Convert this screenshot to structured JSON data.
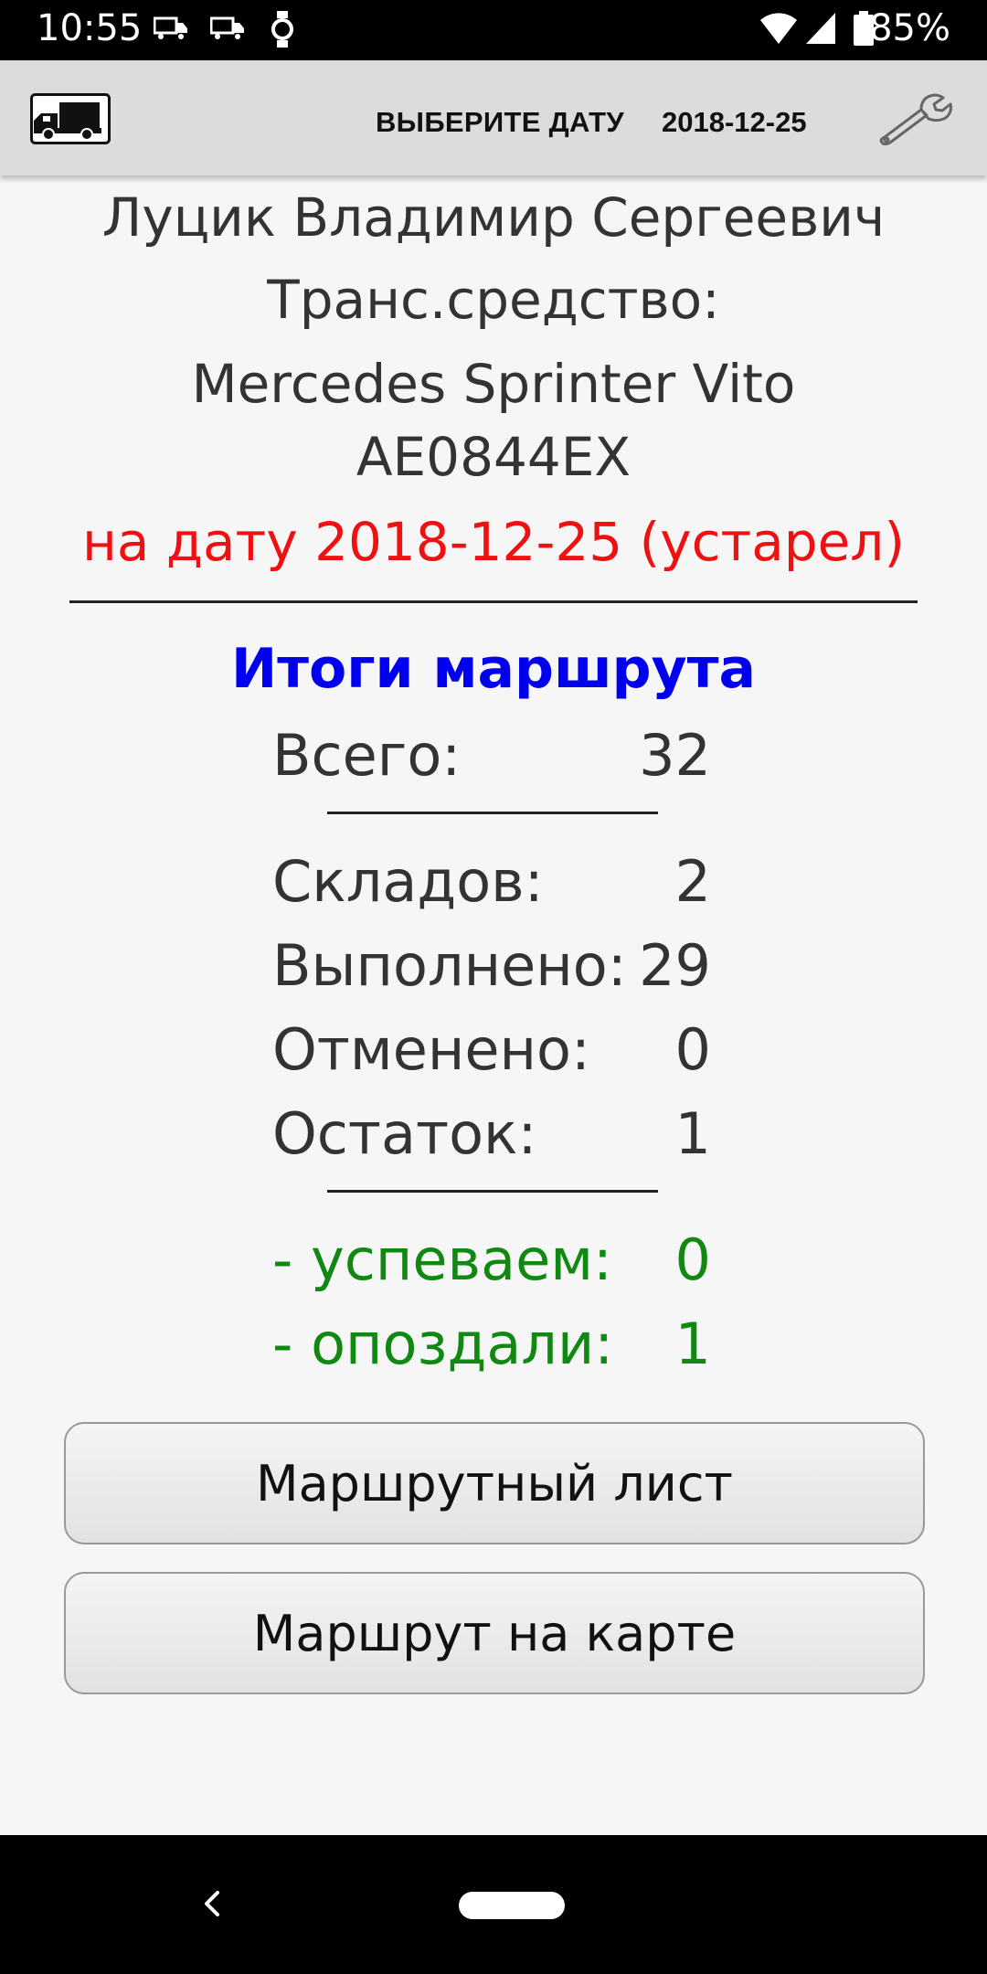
{
  "status_bar": {
    "time": "10:55",
    "battery": "85%"
  },
  "app_bar": {
    "date_label": "ВЫБЕРИТЕ ДАТУ",
    "date_value": "2018-12-25"
  },
  "driver": {
    "name": "Луцик Владимир Сергеевич",
    "vehicle_label": "Транс.средство:",
    "vehicle_model": "Mercedes Sprinter Vito",
    "plate": "AE0844EX",
    "status_line": "на дату 2018-12-25 (устарел)"
  },
  "summary": {
    "title": "Итоги маршрута",
    "total": {
      "label": "Всего:",
      "value": "32"
    },
    "warehouses": {
      "label": "Складов:",
      "value": "2"
    },
    "done": {
      "label": "Выполнено:",
      "value": "29"
    },
    "cancelled": {
      "label": "Отменено:",
      "value": "0"
    },
    "remaining": {
      "label": "Остаток:",
      "value": "1"
    },
    "on_time": {
      "label": "- успеваем:",
      "value": "0"
    },
    "late": {
      "label": "- опоздали:",
      "value": "1"
    }
  },
  "buttons": {
    "route_sheet": "Маршрутный лист",
    "route_map": "Маршрут на карте"
  },
  "colors": {
    "status_red": "#ee1111",
    "title_blue": "#0000ee",
    "green": "#118811"
  }
}
